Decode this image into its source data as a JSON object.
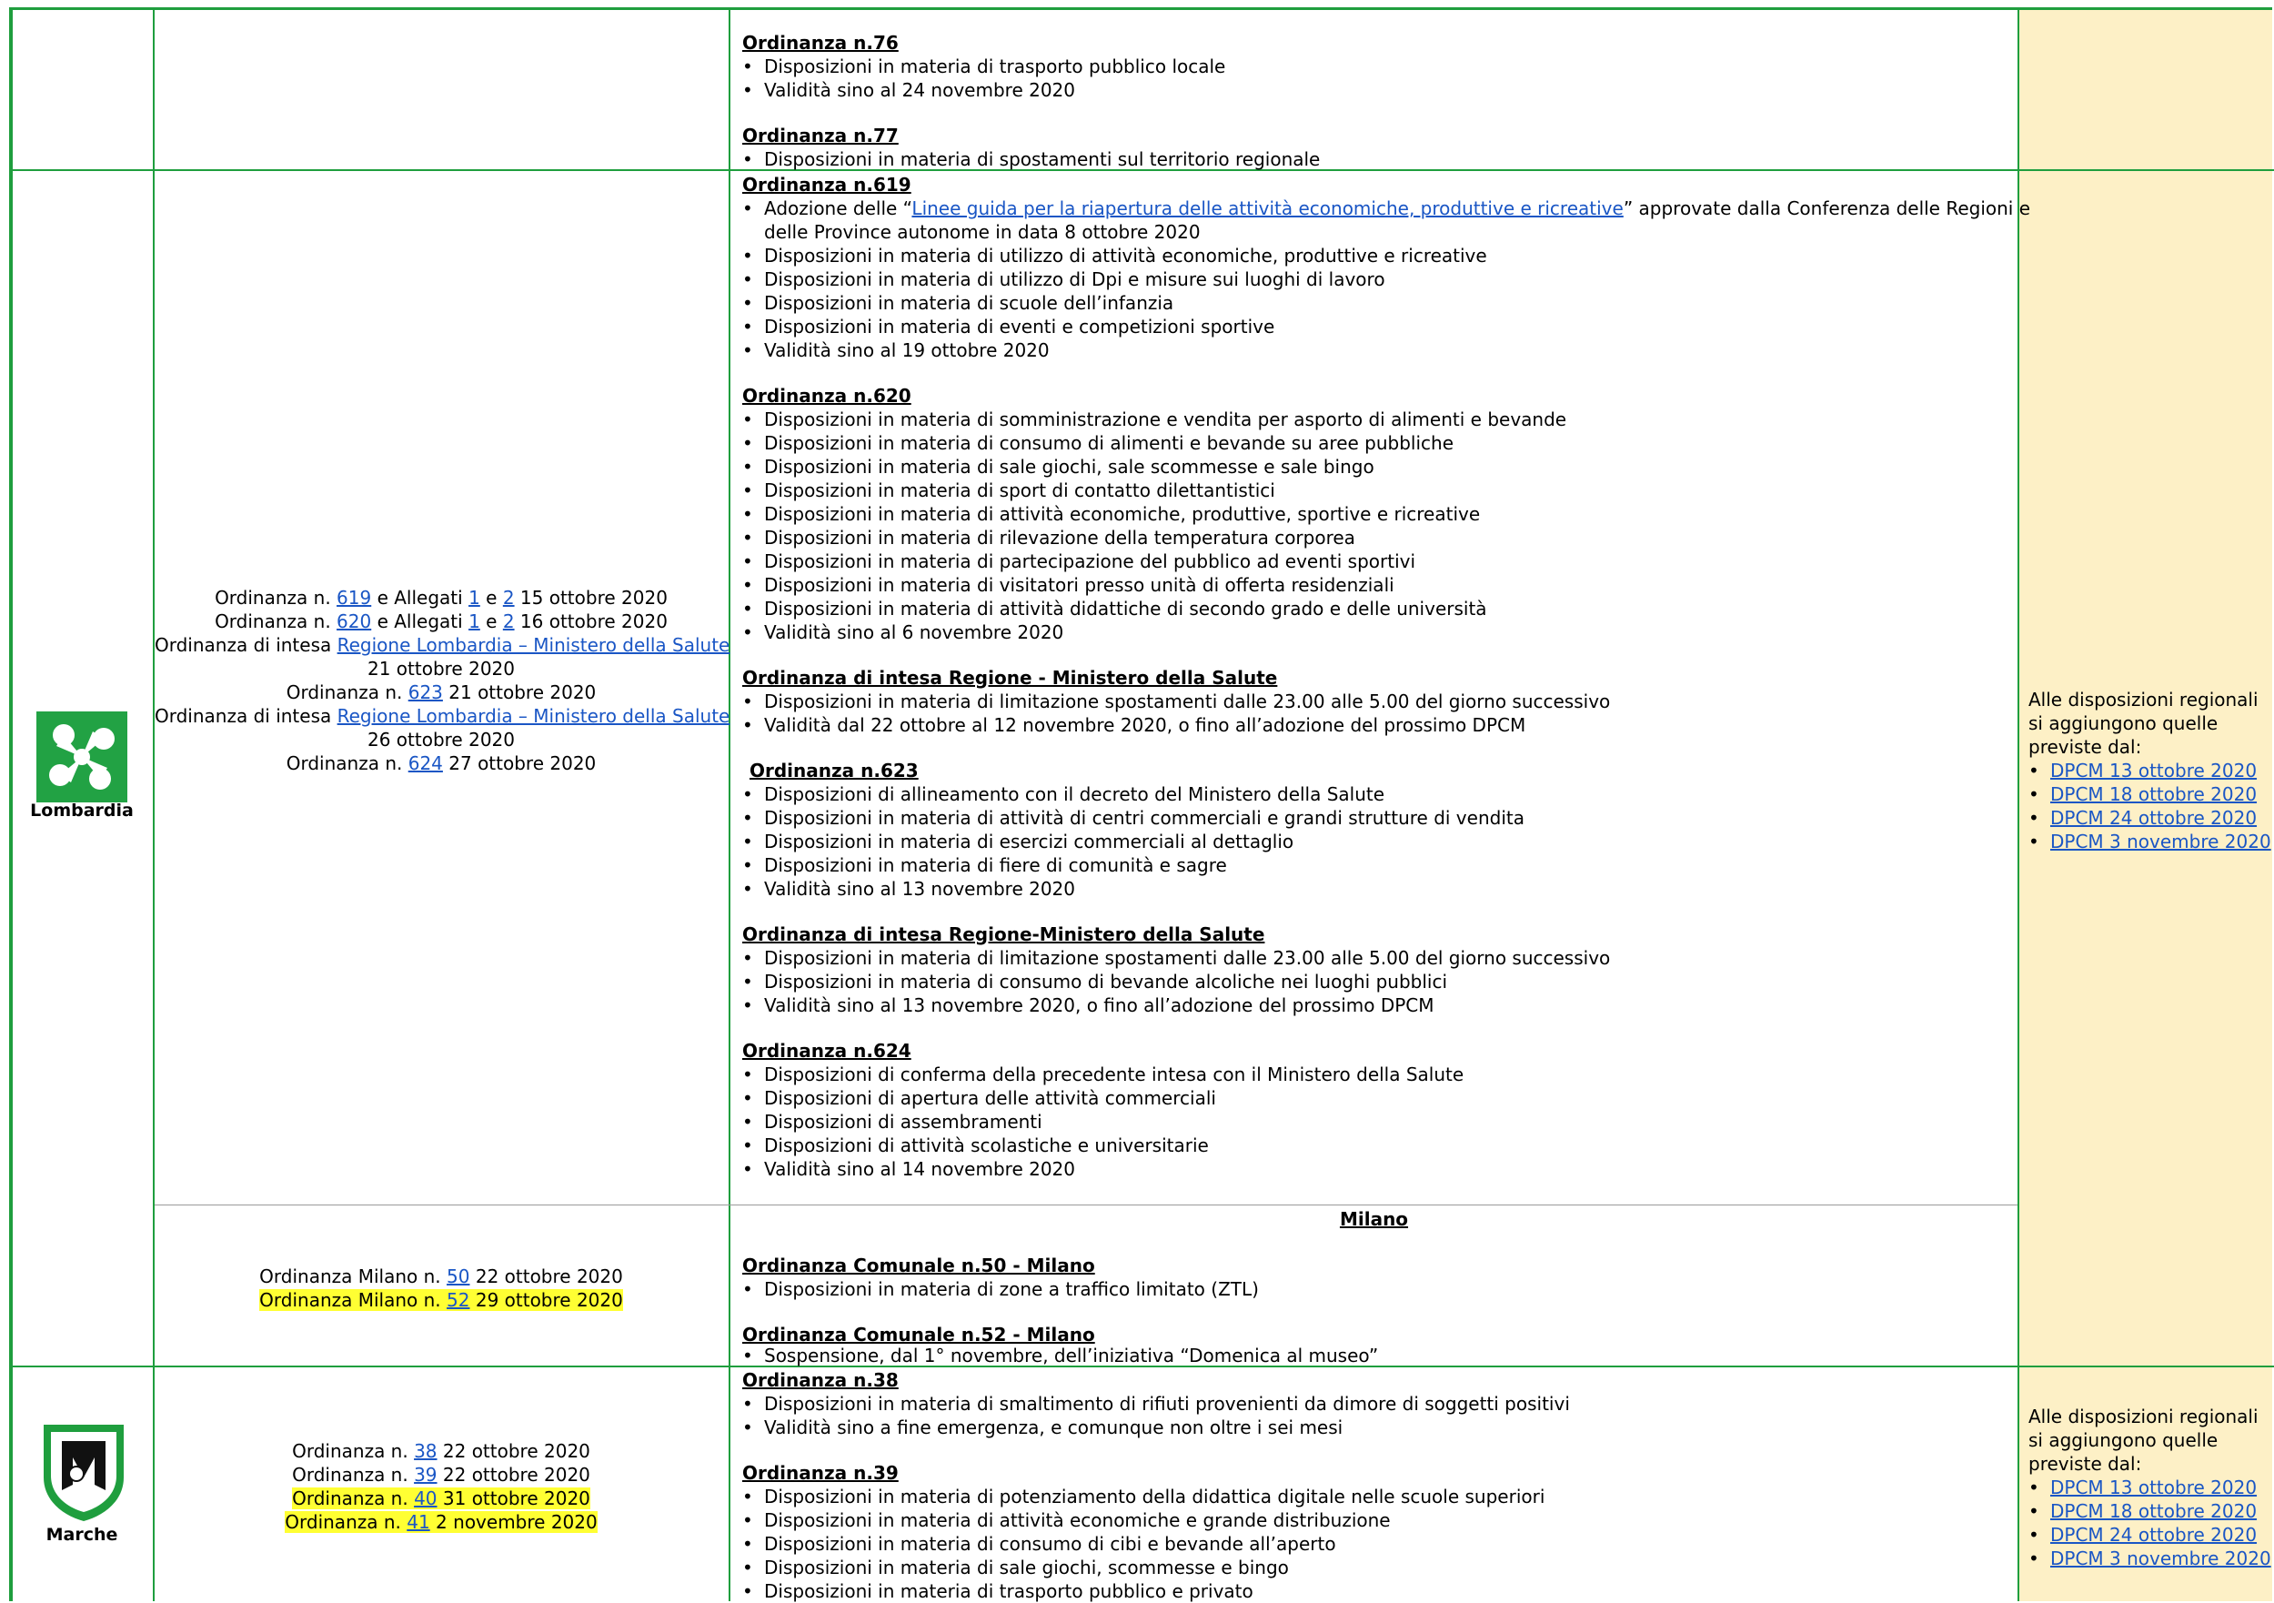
{
  "block_prev": {
    "o76_title": "Ordinanza n.76",
    "o76_items": [
      "Disposizioni in materia di trasporto pubblico locale",
      "Validità sino al 24 novembre 2020"
    ],
    "o77_title": "Ordinanza n.77",
    "o77_items": [
      "Disposizioni in materia di spostamenti sul territorio regionale"
    ]
  },
  "lombardia": {
    "region_name": "Lombardia",
    "refs": {
      "r1_a": "Ordinanza n. ",
      "r1_link": "619",
      "r1_b": " e Allegati ",
      "r1_l1": "1",
      "r1_c": " e ",
      "r1_l2": "2",
      "r1_d": " 15 ottobre 2020",
      "r2_a": "Ordinanza n. ",
      "r2_link": "620",
      "r2_b": " e Allegati ",
      "r2_l1": "1",
      "r2_c": " e ",
      "r2_l2": "2",
      "r2_d": " 16 ottobre 2020",
      "r3_a": "Ordinanza di intesa ",
      "r3_link": "Regione Lombardia – Ministero della Salute",
      "r3_date": "21 ottobre 2020",
      "r4_a": "Ordinanza n. ",
      "r4_link": "623",
      "r4_b": " 21 ottobre 2020",
      "r5_a": "Ordinanza di intesa ",
      "r5_link": "Regione Lombardia – Ministero della Salute",
      "r5_date": "26 ottobre 2020",
      "r6_a": "Ordinanza n. ",
      "r6_link": "624",
      "r6_b": " 27 ottobre 2020"
    },
    "o619_title": "Ordinanza n.619",
    "o619_first_pre": "Adozione delle “",
    "o619_first_link": "Linee guida per la riapertura delle attività economiche, produttive e ricreative",
    "o619_first_post": "” approvate dalla Conferenza delle Regioni e",
    "o619_first_cont": "delle Province autonome in data 8 ottobre 2020",
    "o619_items": [
      "Disposizioni in materia di utilizzo di attività economiche, produttive e ricreative",
      "Disposizioni in materia di utilizzo di Dpi e misure sui luoghi di lavoro",
      "Disposizioni in materia di scuole dell’infanzia",
      "Disposizioni in materia di eventi e competizioni sportive",
      "Validità sino al 19 ottobre 2020"
    ],
    "o620_title": "Ordinanza n.620",
    "o620_items": [
      "Disposizioni in materia di somministrazione e vendita per asporto di alimenti e bevande",
      "Disposizioni in materia di consumo di alimenti e bevande su aree pubbliche",
      "Disposizioni in materia di sale giochi, sale scommesse e sale bingo",
      "Disposizioni in materia di sport di contatto dilettantistici",
      "Disposizioni in materia di attività economiche, produttive, sportive e ricreative",
      "Disposizioni in materia di rilevazione della temperatura corporea",
      "Disposizioni in materia di partecipazione del pubblico ad eventi sportivi",
      "Disposizioni in materia di visitatori presso unità di offerta residenziali",
      "Disposizioni in materia di attività didattiche di secondo grado e delle università",
      "Validità sino al 6 novembre 2020"
    ],
    "intesa1_title": "Ordinanza di intesa Regione - Ministero della Salute",
    "intesa1_items": [
      "Disposizioni in materia di limitazione spostamenti dalle 23.00 alle 5.00 del giorno successivo",
      "Validità dal 22 ottobre al 12 novembre 2020, o fino all’adozione del prossimo DPCM"
    ],
    "o623_title": "Ordinanza n.623",
    "o623_items": [
      "Disposizioni di allineamento con il decreto del Ministero della Salute",
      "Disposizioni in materia di attività di centri commerciali e grandi strutture di vendita",
      "Disposizioni in materia di esercizi commerciali al dettaglio",
      "Disposizioni in materia di fiere di comunità e sagre",
      "Validità sino al 13 novembre 2020"
    ],
    "intesa2_title": "Ordinanza di intesa Regione-Ministero della Salute",
    "intesa2_items": [
      "Disposizioni in materia di limitazione spostamenti dalle 23.00 alle 5.00 del giorno successivo",
      "Disposizioni in materia di consumo di bevande alcoliche nei luoghi pubblici",
      "Validità sino al 13 novembre 2020, o fino all’adozione del prossimo DPCM"
    ],
    "o624_title": "Ordinanza n.624",
    "o624_items": [
      "Disposizioni di conferma della precedente intesa con il Ministero della Salute",
      "Disposizioni di apertura delle attività commerciali",
      "Disposizioni di assembramenti",
      "Disposizioni di attività scolastiche e universitarie",
      "Validità sino al 14 novembre 2020"
    ],
    "milano": {
      "heading": "Milano",
      "ref1_a": "Ordinanza Milano n. ",
      "ref1_link": "50",
      "ref1_b": " 22 ottobre 2020",
      "ref2_a": "Ordinanza Milano n. ",
      "ref2_link": "52",
      "ref2_b": " 29 ottobre 2020",
      "c50_title": "Ordinanza Comunale n.50 - Milano",
      "c50_items": [
        "Disposizioni in materia di zone a traffico limitato (ZTL)"
      ],
      "c52_title": "Ordinanza Comunale n.52 - Milano",
      "c52_items": [
        "Sospensione, dal 1° novembre, dell’iniziativa “Domenica al museo”"
      ]
    },
    "notes": {
      "l1": "Alle disposizioni regionali",
      "l2": "si aggiungono quelle",
      "l3": "previste dal:",
      "links": [
        "DPCM 13 ottobre 2020",
        "DPCM 18 ottobre 2020",
        "DPCM 24 ottobre 2020",
        "DPCM 3 novembre 2020"
      ]
    }
  },
  "marche": {
    "region_name": "Marche",
    "refs": {
      "r1_a": "Ordinanza n. ",
      "r1_link": "38",
      "r1_b": " 22 ottobre 2020",
      "r2_a": "Ordinanza n. ",
      "r2_link": "39",
      "r2_b": " 22 ottobre 2020",
      "r3_a": "Ordinanza n. ",
      "r3_link": "40",
      "r3_b": " 31 ottobre 2020",
      "r4_a": "Ordinanza n. ",
      "r4_link": "41",
      "r4_b": " 2 novembre 2020"
    },
    "o38_title": "Ordinanza n.38",
    "o38_items": [
      "Disposizioni in materia di smaltimento di rifiuti provenienti da dimore di soggetti positivi",
      "Validità sino a fine emergenza, e comunque non oltre i sei mesi"
    ],
    "o39_title": "Ordinanza n.39",
    "o39_items": [
      "Disposizioni in materia di potenziamento della didattica digitale nelle scuole superiori",
      "Disposizioni in materia di attività economiche e grande distribuzione",
      "Disposizioni in materia di consumo di cibi e bevande all’aperto",
      "Disposizioni in materia di sale giochi, scommesse e bingo",
      "Disposizioni in materia di trasporto pubblico e privato"
    ],
    "notes": {
      "l1": "Alle disposizioni regionali",
      "l2": "si aggiungono quelle",
      "l3": "previste dal:",
      "links": [
        "DPCM 13 ottobre 2020",
        "DPCM 18 ottobre 2020",
        "DPCM 24 ottobre 2020",
        "DPCM 3 novembre 2020"
      ]
    }
  },
  "colors": {
    "border": "#1f9e3e",
    "notes_bg": "#fdf0c6",
    "link": "#1a56c5",
    "highlight": "#ffff33"
  }
}
